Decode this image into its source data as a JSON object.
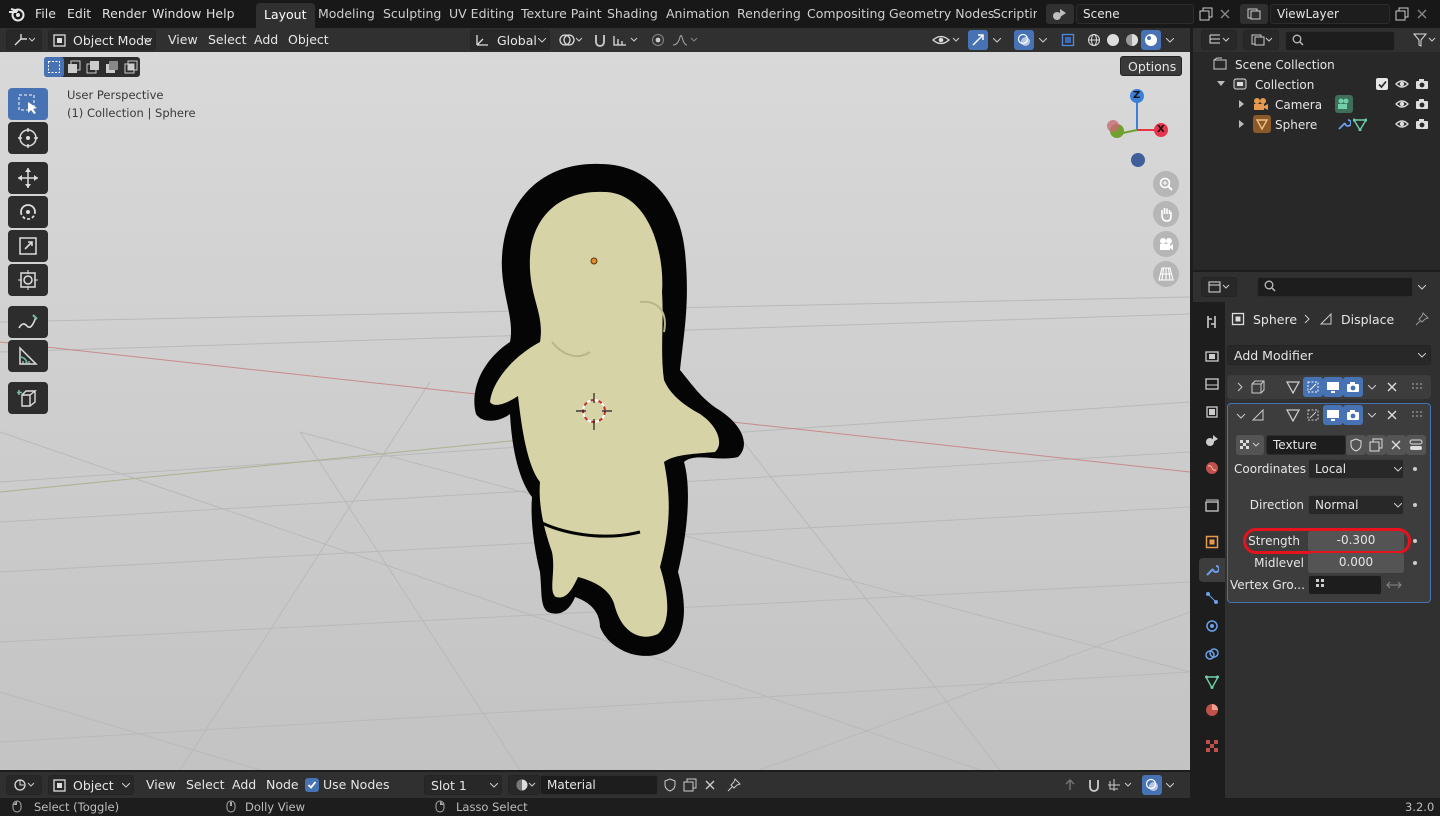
{
  "menubar": {
    "file": "File",
    "edit": "Edit",
    "render": "Render",
    "window": "Window",
    "help": "Help"
  },
  "workspaces": [
    "Layout",
    "Modeling",
    "Sculpting",
    "UV Editing",
    "Texture Paint",
    "Shading",
    "Animation",
    "Rendering",
    "Compositing",
    "Geometry Nodes",
    "Scripting"
  ],
  "scene": {
    "name": "Scene"
  },
  "view_layer": {
    "name": "ViewLayer"
  },
  "header": {
    "mode": "Object Mode",
    "view": "View",
    "select": "Select",
    "add": "Add",
    "object": "Object",
    "orientation": "Global"
  },
  "viewport": {
    "options": "Options",
    "perspective_label": "User Perspective",
    "collection_label": "(1) Collection | Sphere",
    "gizmo": {
      "z": "Z",
      "x": "X"
    }
  },
  "outliner": {
    "scene_collection": "Scene Collection",
    "collection": "Collection",
    "items": [
      {
        "name": "Camera"
      },
      {
        "name": "Sphere"
      }
    ]
  },
  "properties": {
    "breadcrumb_object": "Sphere",
    "breadcrumb_modifier": "Displace",
    "add_modifier": "Add Modifier",
    "texture_name": "Texture",
    "coordinates_label": "Coordinates",
    "coordinates_value": "Local",
    "direction_label": "Direction",
    "direction_value": "Normal",
    "strength_label": "Strength",
    "strength_value": "-0.300",
    "midlevel_label": "Midlevel",
    "midlevel_value": "0.000",
    "vertex_group_label": "Vertex Gro..."
  },
  "bottom_header": {
    "editor": "Object",
    "view": "View",
    "select": "Select",
    "add": "Add",
    "node": "Node",
    "use_nodes": "Use Nodes",
    "slot": "Slot 1",
    "material": "Material"
  },
  "statusbar": {
    "select": "Select (Toggle)",
    "dolly": "Dolly View",
    "lasso": "Lasso Select",
    "version": "3.2.0"
  },
  "colors": {
    "accent": "#4772b3",
    "highlight_circle": "#e8121e",
    "mesh_fill": "#d6d4a6",
    "outline": "#000000",
    "axis_x": "#e8344a",
    "axis_y": "#6ea12e",
    "axis_z": "#3a7fd8"
  }
}
